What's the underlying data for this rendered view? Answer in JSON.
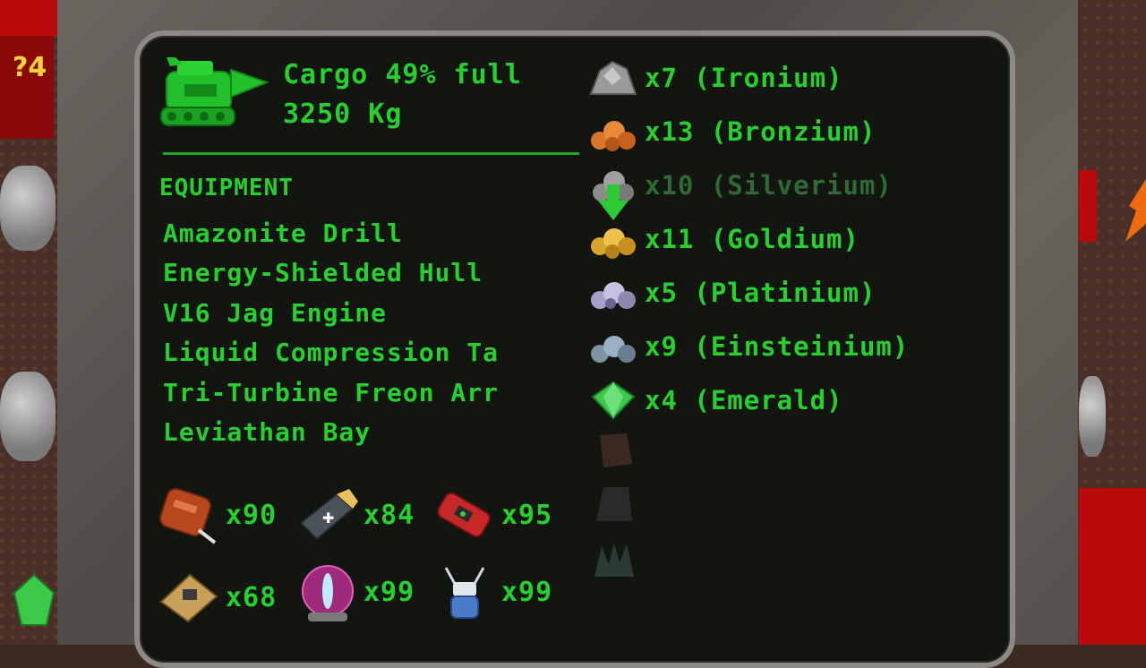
{
  "hud": {
    "score_fragment": "?4"
  },
  "cargo": {
    "fill_text": "Cargo 49% full",
    "fill_percent": 49,
    "weight_text": "3250 Kg"
  },
  "equipment": {
    "heading": "EQUIPMENT",
    "items": [
      "Amazonite Drill",
      "Energy-Shielded Hull",
      "V16 Jag Engine",
      "Liquid Compression Ta",
      "Tri-Turbine Freon Arr",
      "Leviathan Bay"
    ]
  },
  "ores": [
    {
      "label": "x7 (Ironium)",
      "icon": "ironium-ore-icon",
      "color": "#9a9a9a",
      "dim": false
    },
    {
      "label": "x13 (Bronzium)",
      "icon": "bronzium-ore-icon",
      "color": "#d9742a",
      "dim": false
    },
    {
      "label": "x10 (Silverium)",
      "icon": "silverium-ore-icon",
      "color": "#8c8c8c",
      "dim": true
    },
    {
      "label": "x11 (Goldium)",
      "icon": "goldium-ore-icon",
      "color": "#d9a42a",
      "dim": false
    },
    {
      "label": "x5 (Platinium)",
      "icon": "platinium-ore-icon",
      "color": "#a8a0c8",
      "dim": false
    },
    {
      "label": "x9 (Einsteinium)",
      "icon": "einsteinium-ore-icon",
      "color": "#7f93a6",
      "dim": false
    },
    {
      "label": "x4 (Emerald)",
      "icon": "emerald-icon",
      "color": "#3ec84a",
      "dim": false
    }
  ],
  "consumables": [
    {
      "count": "x90",
      "icon": "fuel-tank-icon"
    },
    {
      "count": "x84",
      "icon": "repair-kit-icon"
    },
    {
      "count": "x95",
      "icon": "dynamite-icon"
    },
    {
      "count": "x68",
      "icon": "plastic-explosive-icon"
    },
    {
      "count": "x99",
      "icon": "teleporter-icon"
    },
    {
      "count": "x99",
      "icon": "matter-transmitter-icon"
    }
  ],
  "colors": {
    "text_green": "#27d02e",
    "panel_bg": "#131511",
    "lava": "#b80a0a"
  }
}
